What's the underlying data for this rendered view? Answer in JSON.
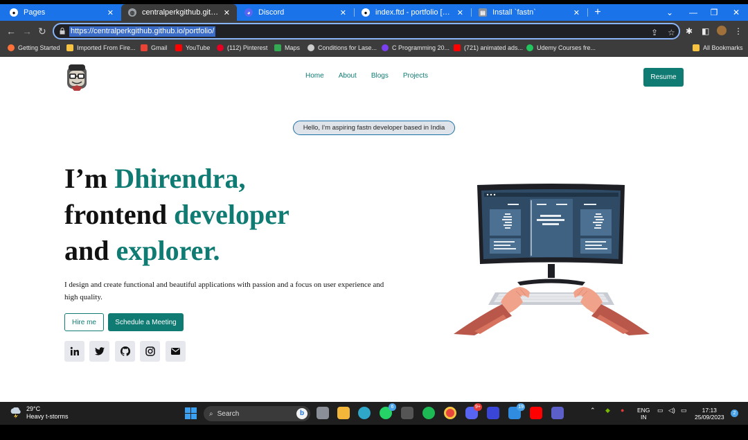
{
  "browser": {
    "tabs": [
      {
        "label": "Pages",
        "active": false
      },
      {
        "label": "centralperkgithub.github.io/port",
        "active": true
      },
      {
        "label": "Discord",
        "active": false
      },
      {
        "label": "index.ftd - portfolio [GitHub] - V",
        "active": false
      },
      {
        "label": "Install `fastn`",
        "active": false
      }
    ],
    "new_tab_label": "+",
    "url": "https://centralperkgithub.github.io/portfolio/",
    "bookmarks": [
      {
        "label": "Getting Started",
        "color": "#ff7139"
      },
      {
        "label": "Imported From Fire...",
        "color": "#f6c343"
      },
      {
        "label": "Gmail",
        "color": "#ea4335"
      },
      {
        "label": "YouTube",
        "color": "#ff0000"
      },
      {
        "label": "(112) Pinterest",
        "color": "#e60023"
      },
      {
        "label": "Maps",
        "color": "#34a853"
      },
      {
        "label": "Conditions for Lase...",
        "color": "#cccccc"
      },
      {
        "label": "C Programming 20...",
        "color": "#7b3ff2"
      },
      {
        "label": "(721) animated ads...",
        "color": "#ff0000"
      },
      {
        "label": "Udemy Courses fre...",
        "color": "#22c55e"
      }
    ],
    "all_bookmarks": "All Bookmarks"
  },
  "site": {
    "nav": [
      "Home",
      "About",
      "Blogs",
      "Projects"
    ],
    "resume_label": "Resume",
    "pill_text": "Hello, I'm aspiring fastn developer based in India",
    "headline": {
      "line1_plain": "I’m ",
      "line1_accent": "Dhirendra,",
      "line2_plain": "frontend ",
      "line2_accent": "developer",
      "line3_plain": "and ",
      "line3_accent": "explorer."
    },
    "description": "I design and create functional and beautiful applications with passion and a focus on user experience and high quality.",
    "hire_label": "Hire me",
    "meeting_label": "Schedule a Meeting",
    "socials": [
      "linkedin-icon",
      "twitter-icon",
      "github-icon",
      "instagram-icon",
      "mail-icon"
    ],
    "accent_color": "#0f7b73"
  },
  "taskbar": {
    "temperature": "29°C",
    "weather": "Heavy t-storms",
    "search_label": "Search",
    "badges": {
      "whatsapp": "6",
      "discord": "9+",
      "mail": "19"
    },
    "lang_top": "ENG",
    "lang_bottom": "IN",
    "time": "17:13",
    "date": "25/09/2023",
    "notifications": "2"
  }
}
